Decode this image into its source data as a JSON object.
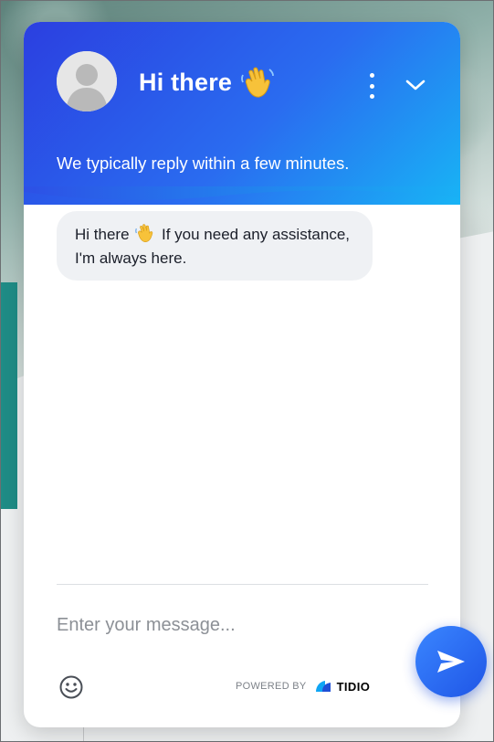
{
  "header": {
    "title": "Hi there",
    "subtitle": "We typically reply within a few minutes."
  },
  "chat": {
    "messages": [
      {
        "text_before": "Hi there",
        "text_after": "If you need any assistance, I'm always here."
      }
    ]
  },
  "composer": {
    "placeholder": "Enter your message..."
  },
  "footer": {
    "powered_by": "POWERED BY",
    "brand": "TIDIO"
  },
  "icons": {
    "avatar": "user-avatar-icon",
    "title_emoji": "waving-hand-icon",
    "menu": "vertical-dots-icon",
    "minimize": "chevron-down-icon",
    "emoji": "smiley-icon",
    "send": "paper-plane-icon"
  },
  "colors": {
    "header_start": "#2b3fe0",
    "header_end": "#18b4f5",
    "send_button": "#2a6cf3"
  }
}
